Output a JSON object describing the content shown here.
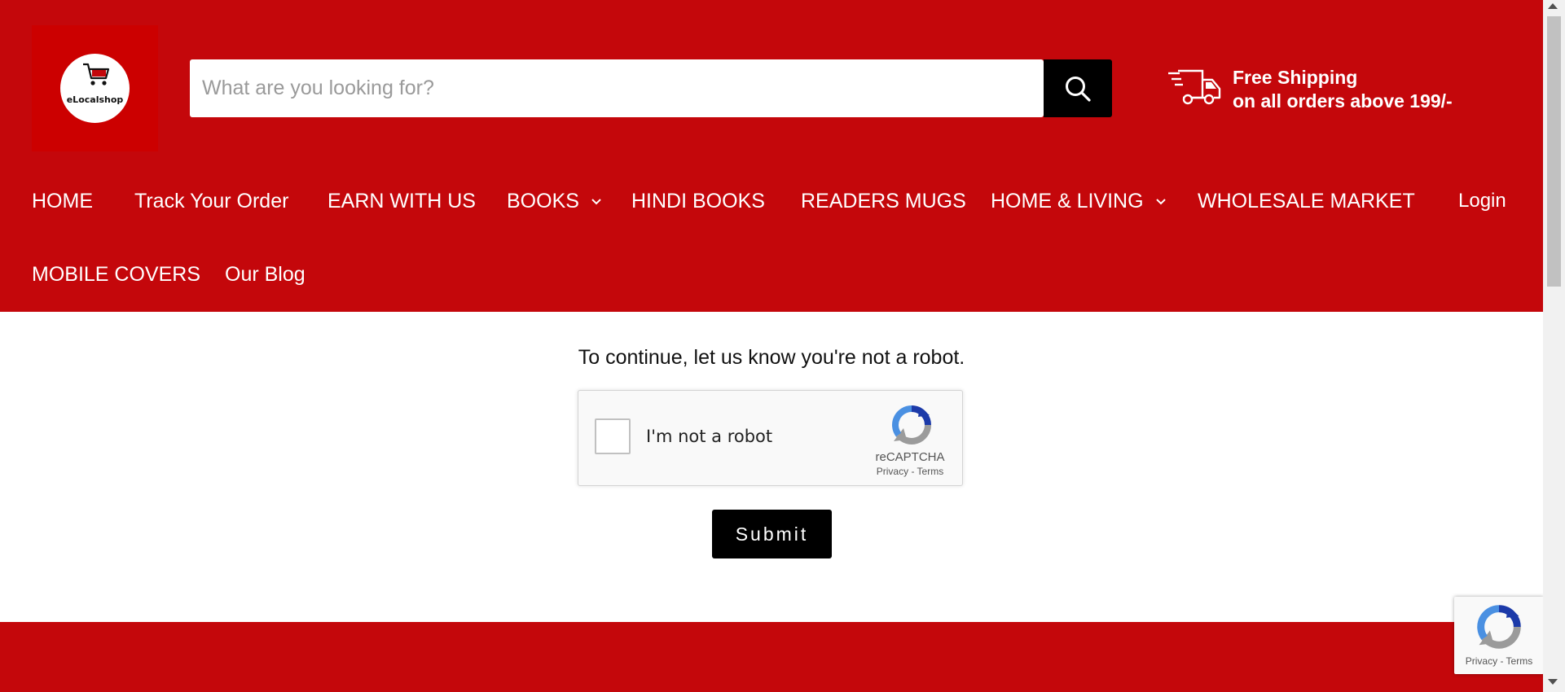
{
  "header": {
    "logo_text": "eLocalshop",
    "logo_icon": "shopping-cart-icon",
    "search": {
      "placeholder": "What are you looking for?",
      "value": "",
      "button_icon": "search-icon"
    },
    "shipping": {
      "icon": "truck-icon",
      "title": "Free Shipping",
      "subtitle": "on all orders above 199/-"
    },
    "colors": {
      "brand": "#c4070b",
      "logo_bg": "#cc0000",
      "search_button": "#000000"
    }
  },
  "nav": {
    "items": [
      {
        "label": "HOME"
      },
      {
        "label": "Track Your Order"
      },
      {
        "label": "EARN WITH US"
      },
      {
        "label": "BOOKS",
        "has_dropdown": true
      },
      {
        "label": "HINDI BOOKS"
      },
      {
        "label": "READERS MUGS"
      },
      {
        "label": "HOME & LIVING",
        "has_dropdown": true
      },
      {
        "label": "WHOLESALE MARKET"
      },
      {
        "label": "MOBILE COVERS"
      },
      {
        "label": "Our Blog"
      }
    ],
    "login": "Login"
  },
  "main": {
    "prompt": "To continue, let us know you're not a robot.",
    "recaptcha": {
      "checkbox_label": "I'm not a robot",
      "checked": false,
      "brand": "reCAPTCHA",
      "links": "Privacy - Terms"
    },
    "submit_label": "Submit"
  },
  "badge": {
    "links": "Privacy - Terms"
  }
}
